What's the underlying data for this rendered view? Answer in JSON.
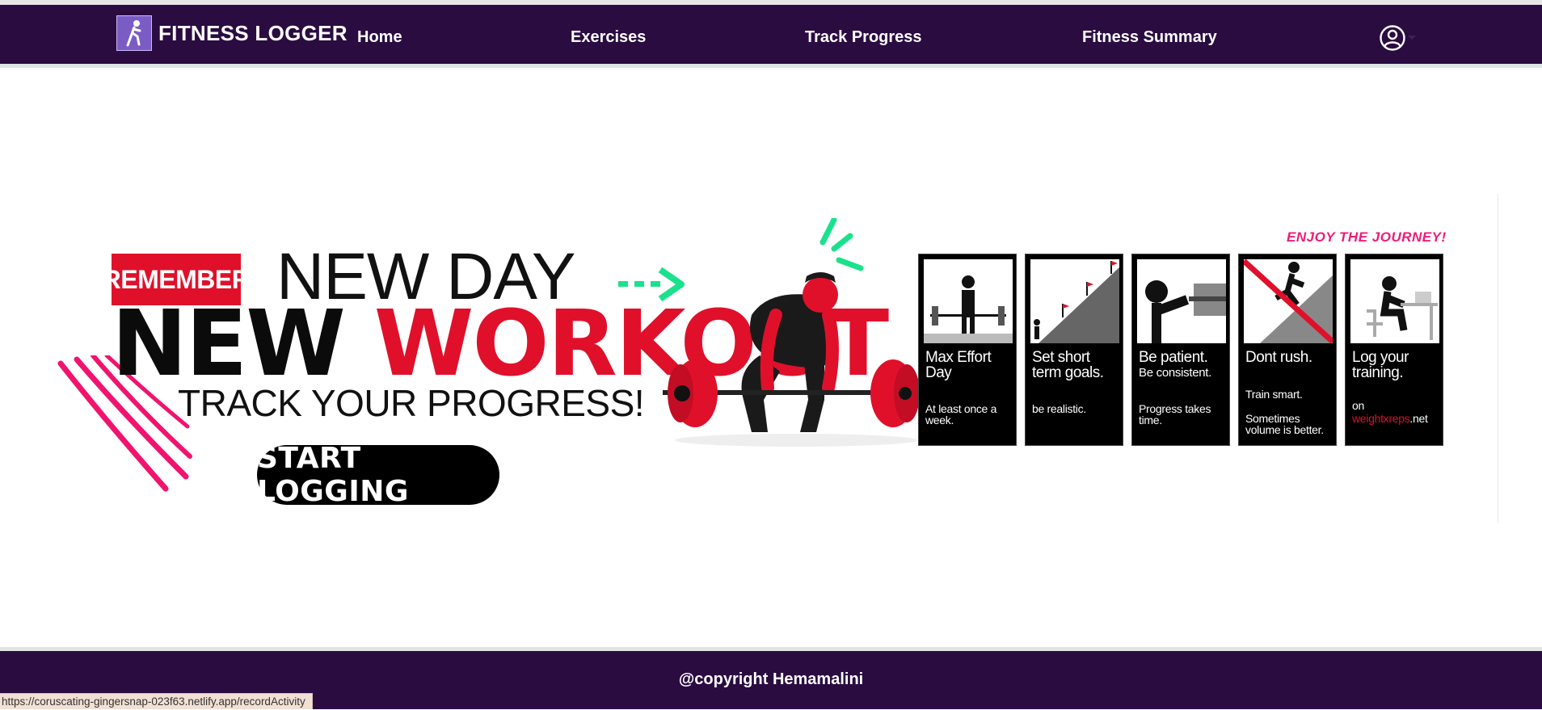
{
  "navbar": {
    "brand": "FITNESS LOGGER",
    "links": [
      "Home",
      "Exercises",
      "Track Progress",
      "Fitness Summary"
    ]
  },
  "hero": {
    "remember": "REMEMBER",
    "new_day": "NEW DAY",
    "new": "NEW",
    "workout": "WORKOUT",
    "track": "TRACK YOUR PROGRESS!",
    "cta": "START LOGGING",
    "enjoy": "ENJOY THE JOURNEY!",
    "panels": [
      {
        "title": "Max Effort Day",
        "body1": "At least once a week.",
        "body2": ""
      },
      {
        "title": "Set short term goals.",
        "body1": "be realistic.",
        "body2": ""
      },
      {
        "title": "Be patient.",
        "sub": "Be consistent.",
        "body1": "Progress takes time.",
        "body2": ""
      },
      {
        "title": "Dont rush.",
        "body1": "Train smart.",
        "body2": "Sometimes volume is better."
      },
      {
        "title": "Log your training.",
        "body1": "on",
        "link": "weightxreps",
        "link_suffix": ".net"
      }
    ]
  },
  "footer": {
    "text": "@copyright Hemamalini"
  },
  "status_bar": {
    "url": "https://coruscating-gingersnap-023f63.netlify.app/recordActivity"
  },
  "colors": {
    "nav_bg": "#2a0c41",
    "accent_red": "#e0102b",
    "accent_pink": "#ee1c78",
    "accent_green": "#19e28c"
  },
  "icons": {
    "brand": "runner-icon",
    "user": "user-circle-icon",
    "caret": "caret-down-icon"
  }
}
